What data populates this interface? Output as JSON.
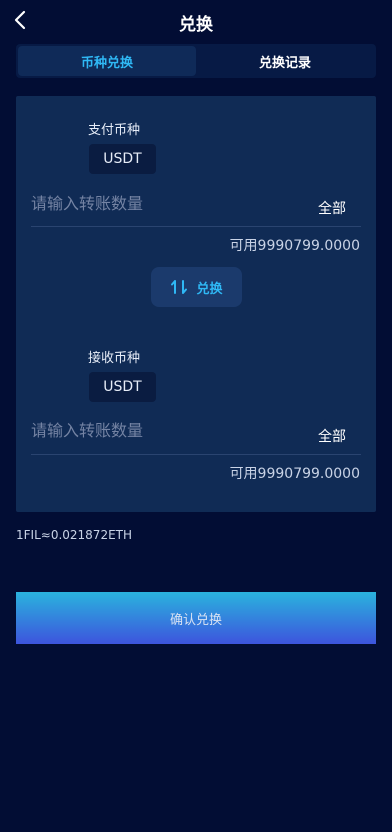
{
  "header": {
    "title": "兑换",
    "back_icon": "chevron-left-icon"
  },
  "tabs": [
    {
      "label": "币种兑换",
      "active": true
    },
    {
      "label": "兑换记录",
      "active": false
    }
  ],
  "pay": {
    "label": "支付币种",
    "coin": "USDT",
    "placeholder": "请输入转账数量",
    "value": "",
    "all_label": "全部",
    "available": "可用9990799.0000"
  },
  "swap": {
    "label": "兑换",
    "icon": "swap-arrows-icon"
  },
  "receive": {
    "label": "接收币种",
    "coin": "USDT",
    "placeholder": "请输入转账数量",
    "value": "",
    "all_label": "全部",
    "available": "可用9990799.0000"
  },
  "rate": "1FIL≈0.021872ETH",
  "confirm_label": "确认兑换",
  "colors": {
    "background": "#020d34",
    "card": "#102b55",
    "accent": "#2fb8f5",
    "button_gradient_top": "#2ab3dd",
    "button_gradient_bottom": "#3d54dd"
  }
}
